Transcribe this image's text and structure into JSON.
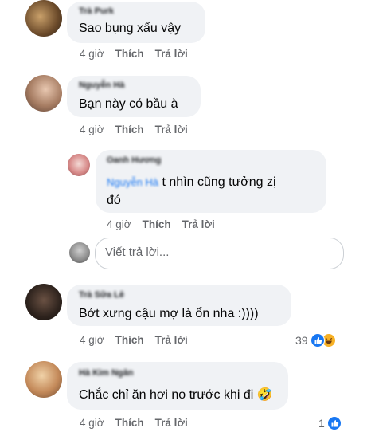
{
  "comments": [
    {
      "author": "Trà Purk",
      "text": "Sao bụng xấu vậy",
      "time": "4 giờ",
      "like": "Thích",
      "reply": "Trả lời"
    },
    {
      "author": "Nguyễn Hà",
      "text": "Bạn này có bầu à",
      "time": "4 giờ",
      "like": "Thích",
      "reply": "Trả lời",
      "replies": [
        {
          "author": "Oanh Hương",
          "mention": "Nguyễn Hà",
          "line1": "t nhìn cũng tưởng zị",
          "line2": "đó",
          "time": "4 giờ",
          "like": "Thích",
          "reply": "Trả lời"
        }
      ],
      "reply_box": {
        "placeholder": "Viết trả lời..."
      }
    },
    {
      "author": "Trà Sữa Lê",
      "text": "Bớt xưng cậu mợ là ổn nha :))))",
      "time": "4 giờ",
      "like": "Thích",
      "reply": "Trả lời",
      "reaction_count": "39",
      "reaction_icons": [
        "like-icon",
        "haha-icon"
      ]
    },
    {
      "author": "Hà Kim Ngân",
      "text": "Chắc chỉ ăn hơi no trước khi đi 🤣",
      "time": "4 giờ",
      "like": "Thích",
      "reply": "Trả lời",
      "reaction_count": "1",
      "reaction_icons": [
        "like-icon"
      ]
    }
  ],
  "colors": {
    "bubble": "#f0f2f5",
    "meta": "#65676b",
    "like_blue": "#1877f2",
    "haha_yellow": "#f7b125"
  }
}
